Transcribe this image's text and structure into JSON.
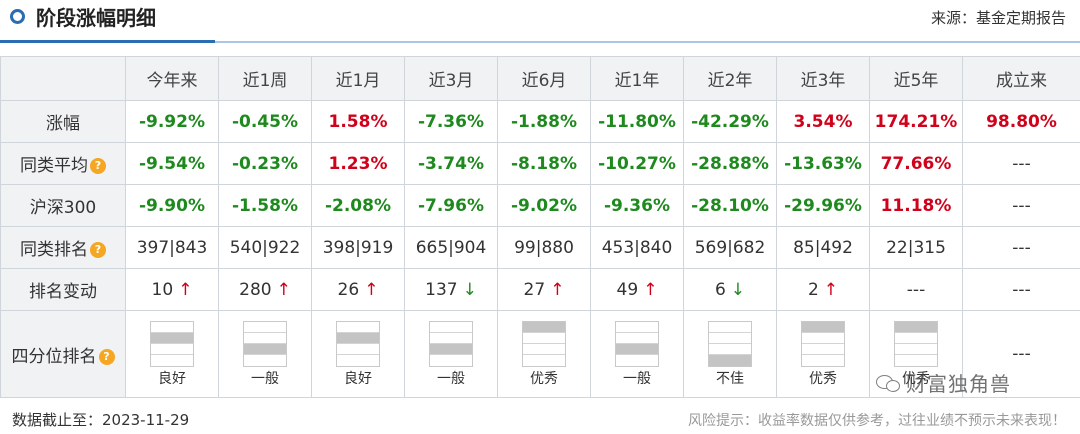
{
  "header": {
    "title": "阶段涨幅明细",
    "source": "来源：基金定期报告"
  },
  "table": {
    "columns": [
      "今年来",
      "近1周",
      "近1月",
      "近3月",
      "近6月",
      "近1年",
      "近2年",
      "近3年",
      "近5年",
      "成立来"
    ],
    "rows": [
      {
        "label": "涨幅",
        "help": false,
        "type": "pct",
        "cells": [
          "-9.92%",
          "-0.45%",
          "1.58%",
          "-7.36%",
          "-1.88%",
          "-11.80%",
          "-42.29%",
          "3.54%",
          "174.21%",
          "98.80%"
        ]
      },
      {
        "label": "同类平均",
        "help": true,
        "type": "pct",
        "cells": [
          "-9.54%",
          "-0.23%",
          "1.23%",
          "-3.74%",
          "-8.18%",
          "-10.27%",
          "-28.88%",
          "-13.63%",
          "77.66%",
          "---"
        ]
      },
      {
        "label": "沪深300",
        "help": false,
        "type": "pct",
        "cells": [
          "-9.90%",
          "-1.58%",
          "-2.08%",
          "-7.96%",
          "-9.02%",
          "-9.36%",
          "-28.10%",
          "-29.96%",
          "11.18%",
          "---"
        ]
      },
      {
        "label": "同类排名",
        "help": true,
        "type": "plain",
        "cells": [
          "397|843",
          "540|922",
          "398|919",
          "665|904",
          "99|880",
          "453|840",
          "569|682",
          "85|492",
          "22|315",
          "---"
        ]
      },
      {
        "label": "排名变动",
        "help": false,
        "type": "change",
        "cells": [
          {
            "value": "10",
            "dir": "up"
          },
          {
            "value": "280",
            "dir": "up"
          },
          {
            "value": "26",
            "dir": "up"
          },
          {
            "value": "137",
            "dir": "down"
          },
          {
            "value": "27",
            "dir": "up"
          },
          {
            "value": "49",
            "dir": "up"
          },
          {
            "value": "6",
            "dir": "down"
          },
          {
            "value": "2",
            "dir": "up"
          },
          {
            "value": "---",
            "dir": ""
          },
          {
            "value": "---",
            "dir": ""
          }
        ]
      }
    ],
    "quartile": {
      "label": "四分位排名",
      "help": true,
      "cells": [
        {
          "rating": "良好",
          "level": 3
        },
        {
          "rating": "一般",
          "level": 2
        },
        {
          "rating": "良好",
          "level": 3
        },
        {
          "rating": "一般",
          "level": 2
        },
        {
          "rating": "优秀",
          "level": 4
        },
        {
          "rating": "一般",
          "level": 2
        },
        {
          "rating": "不佳",
          "level": 1
        },
        {
          "rating": "优秀",
          "level": 4
        },
        {
          "rating": "优秀",
          "level": 4
        },
        {
          "rating": "---",
          "level": 0
        }
      ]
    }
  },
  "footer": {
    "date_text": "数据截止至：2023-11-29",
    "risk_text": "风险提示：收益率数据仅供参考，过往业绩不预示未来表现！"
  },
  "watermark": {
    "text": "财富独角兽"
  },
  "colors": {
    "positive": "#d0021b",
    "negative": "#1e8a1e",
    "accent": "#2a6db0",
    "help_icon": "#f5a623"
  },
  "icons": {
    "help": "question-circle-icon",
    "up": "arrow-up-icon",
    "down": "arrow-down-icon",
    "title": "ring-icon",
    "watermark": "wechat-icon"
  }
}
